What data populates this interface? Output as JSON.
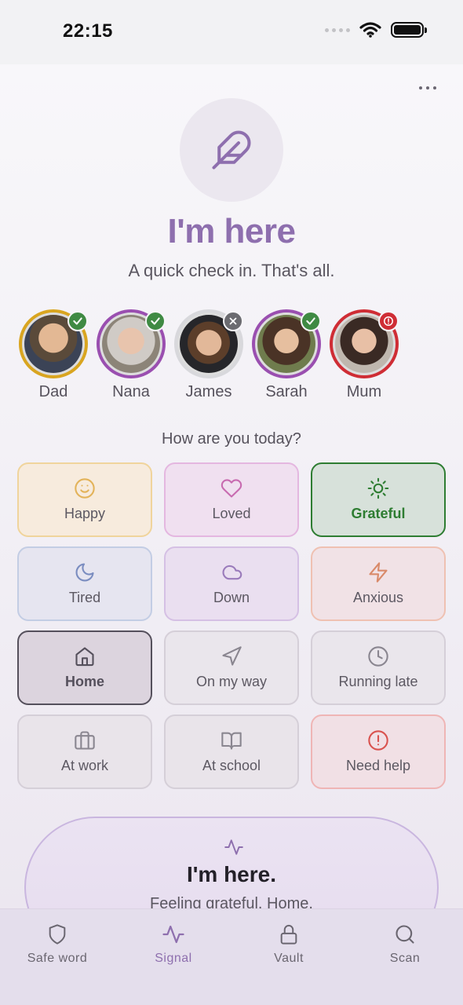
{
  "status_bar": {
    "time": "22:15"
  },
  "header": {
    "title": "I'm here",
    "subtitle": "A quick check in. That's all."
  },
  "contacts": [
    {
      "name": "Dad",
      "ring_color": "#d9a520",
      "status": "checked"
    },
    {
      "name": "Nana",
      "ring_color": "#9a4fb0",
      "status": "checked"
    },
    {
      "name": "James",
      "ring_color": "#d8d8dc",
      "status": "declined"
    },
    {
      "name": "Sarah",
      "ring_color": "#9a4fb0",
      "status": "checked"
    },
    {
      "name": "Mum",
      "ring_color": "#cf2d35",
      "status": "alert"
    }
  ],
  "mood": {
    "question": "How are you today?",
    "tiles": [
      {
        "label": "Happy",
        "icon": "smile-icon",
        "accent": "#e3b35a"
      },
      {
        "label": "Loved",
        "icon": "heart-icon",
        "accent": "#c86bb0"
      },
      {
        "label": "Grateful",
        "icon": "sun-icon",
        "accent": "#2e7d32",
        "selected": true
      },
      {
        "label": "Tired",
        "icon": "moon-icon",
        "accent": "#7b8dc0"
      },
      {
        "label": "Down",
        "icon": "cloud-icon",
        "accent": "#9a7bbb"
      },
      {
        "label": "Anxious",
        "icon": "bolt-icon",
        "accent": "#d98a6a"
      },
      {
        "label": "Home",
        "icon": "home-icon",
        "accent": "#55505c",
        "selected": true
      },
      {
        "label": "On my way",
        "icon": "navigation-icon",
        "accent": "#8a8690"
      },
      {
        "label": "Running late",
        "icon": "clock-icon",
        "accent": "#8a8690"
      },
      {
        "label": "At work",
        "icon": "briefcase-icon",
        "accent": "#8a8690"
      },
      {
        "label": "At school",
        "icon": "book-icon",
        "accent": "#8a8690"
      },
      {
        "label": "Need help",
        "icon": "alert-circle-icon",
        "accent": "#d9534f"
      }
    ]
  },
  "checkin_button": {
    "title": "I'm here.",
    "subtitle": "Feeling grateful. Home."
  },
  "tabs": [
    {
      "label": "Safe word",
      "icon": "shield-icon"
    },
    {
      "label": "Signal",
      "icon": "pulse-icon",
      "active": true
    },
    {
      "label": "Vault",
      "icon": "lock-icon"
    },
    {
      "label": "Scan",
      "icon": "search-icon"
    }
  ],
  "colors": {
    "accent": "#8e6fae",
    "selected_green": "#2e7d32"
  }
}
